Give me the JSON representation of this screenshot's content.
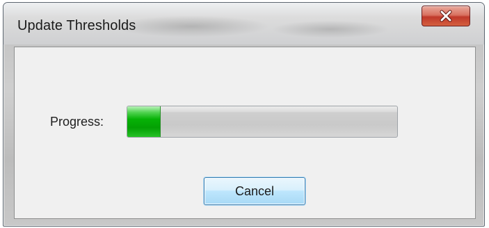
{
  "window": {
    "title": "Update Thresholds",
    "close_icon": "close-icon"
  },
  "progress": {
    "label": "Progress:",
    "fraction": 0.12,
    "fill_color": "#06b206"
  },
  "buttons": {
    "cancel_label": "Cancel"
  },
  "colors": {
    "close_button": "#c0392b",
    "default_button_border": "#3c7fb1"
  }
}
